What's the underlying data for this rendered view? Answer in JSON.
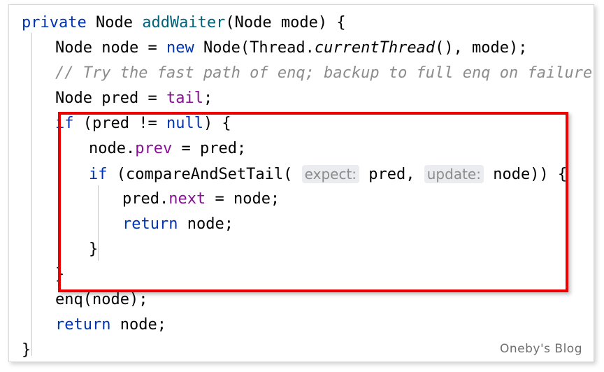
{
  "editor": {
    "language": "Java",
    "method_name": "addWaiter",
    "colors": {
      "keyword": "#0033b3",
      "method": "#00627a",
      "field": "#871094",
      "comment": "#8c8c8c",
      "plain": "#000000",
      "hint_background": "#ebecf0",
      "hint_text": "#8c8c8c",
      "annotation": "#ee0000",
      "indent_guide": "#c9c9c9",
      "background": "#ffffff"
    },
    "lines": [
      {
        "id": "line-signature",
        "indent": 0,
        "tokens": [
          {
            "text": "private",
            "style": "kw"
          },
          {
            "text": " ",
            "style": "plain"
          },
          {
            "text": "Node",
            "style": "plain"
          },
          {
            "text": " ",
            "style": "plain"
          },
          {
            "text": "addWaiter",
            "style": "method"
          },
          {
            "text": "(Node mode) {",
            "style": "plain"
          }
        ]
      },
      {
        "id": "line-node-decl",
        "indent": 1,
        "tokens": [
          {
            "text": "Node node = ",
            "style": "plain"
          },
          {
            "text": "new",
            "style": "kw"
          },
          {
            "text": " Node(Thread.",
            "style": "plain"
          },
          {
            "text": "currentThread",
            "style": "ital"
          },
          {
            "text": "(), mode);",
            "style": "plain"
          }
        ]
      },
      {
        "id": "line-comment",
        "indent": 1,
        "tokens": [
          {
            "text": "// Try the fast path of enq; backup to full enq on failure",
            "style": "comment"
          }
        ]
      },
      {
        "id": "line-pred-decl",
        "indent": 1,
        "tokens": [
          {
            "text": "Node pred = ",
            "style": "plain"
          },
          {
            "text": "tail",
            "style": "field"
          },
          {
            "text": ";",
            "style": "plain"
          }
        ]
      },
      {
        "id": "line-if-pred",
        "indent": 1,
        "tokens": [
          {
            "text": "if",
            "style": "kw"
          },
          {
            "text": " (pred != ",
            "style": "plain"
          },
          {
            "text": "null",
            "style": "kw"
          },
          {
            "text": ") {",
            "style": "plain"
          }
        ]
      },
      {
        "id": "line-node-prev",
        "indent": 2,
        "tokens": [
          {
            "text": "node.",
            "style": "plain"
          },
          {
            "text": "prev",
            "style": "field"
          },
          {
            "text": " = pred;",
            "style": "plain"
          }
        ]
      },
      {
        "id": "line-cas-tail",
        "indent": 2,
        "tokens": [
          {
            "text": "if",
            "style": "kw"
          },
          {
            "text": " (compareAndSetTail(",
            "style": "plain"
          },
          {
            "text": " ",
            "style": "plain"
          },
          {
            "text": "expect:",
            "style": "hint"
          },
          {
            "text": " pred, ",
            "style": "plain"
          },
          {
            "text": "update:",
            "style": "hint"
          },
          {
            "text": " node)) {",
            "style": "plain"
          }
        ]
      },
      {
        "id": "line-pred-next",
        "indent": 3,
        "tokens": [
          {
            "text": "pred.",
            "style": "plain"
          },
          {
            "text": "next",
            "style": "field"
          },
          {
            "text": " = node;",
            "style": "plain"
          }
        ]
      },
      {
        "id": "line-return-node-inner",
        "indent": 3,
        "tokens": [
          {
            "text": "return",
            "style": "kw"
          },
          {
            "text": " node;",
            "style": "plain"
          }
        ]
      },
      {
        "id": "line-close-inner-if",
        "indent": 2,
        "tokens": [
          {
            "text": "}",
            "style": "plain"
          }
        ]
      },
      {
        "id": "line-close-outer-if",
        "indent": 1,
        "tokens": [
          {
            "text": "}",
            "style": "plain"
          }
        ]
      },
      {
        "id": "line-enq",
        "indent": 1,
        "tokens": [
          {
            "text": "enq(node);",
            "style": "plain"
          }
        ]
      },
      {
        "id": "line-return-node-outer",
        "indent": 1,
        "tokens": [
          {
            "text": "return",
            "style": "kw"
          },
          {
            "text": " node;",
            "style": "plain"
          }
        ]
      },
      {
        "id": "line-close-method",
        "indent": 0,
        "tokens": [
          {
            "text": "}",
            "style": "plain"
          }
        ]
      }
    ]
  },
  "annotation": {
    "shape": "rectangle",
    "color": "#ee0000",
    "covers_lines": "if (pred != null) { ... }"
  },
  "watermark": {
    "text": "Oneby's Blog"
  }
}
